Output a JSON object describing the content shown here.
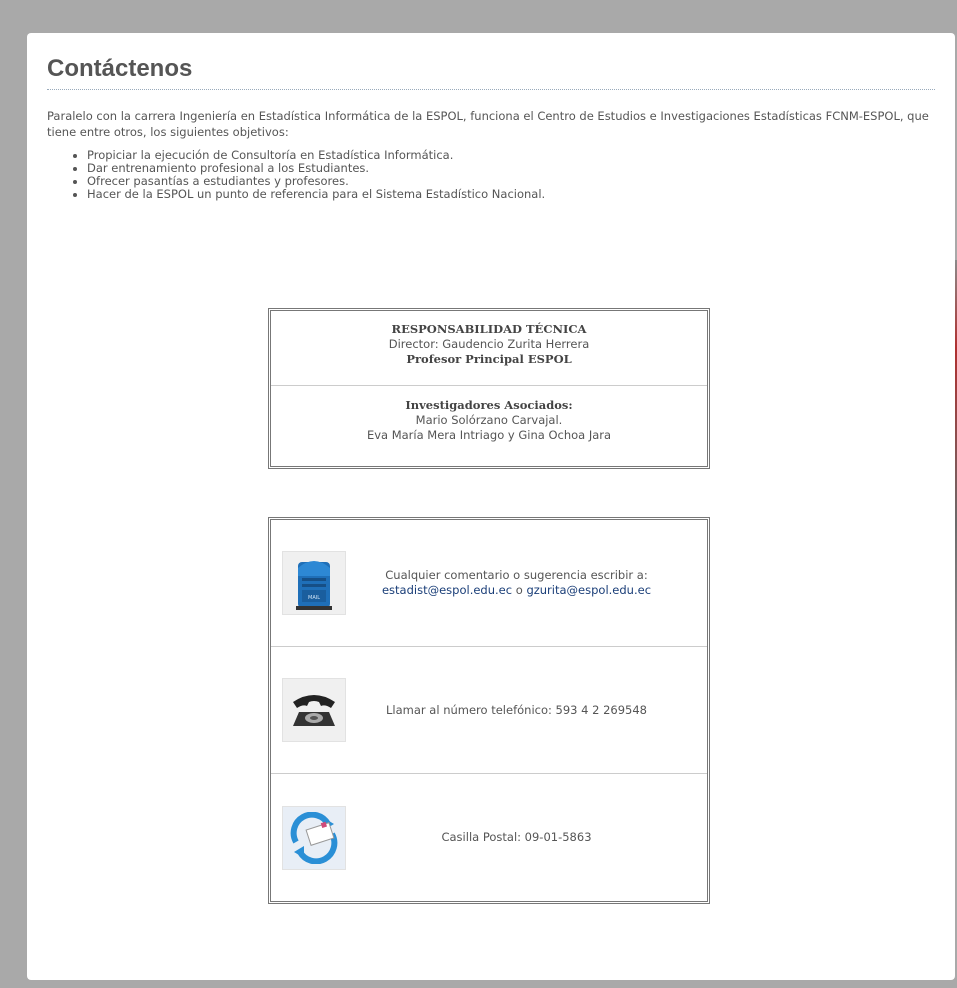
{
  "page": {
    "title": "Contáctenos",
    "intro": "Paralelo con la carrera Ingeniería en Estadística Informática de la ESPOL, funciona el Centro de Estudios e Investigaciones Estadísticas FCNM-ESPOL, que tiene entre otros, los siguientes objetivos:",
    "objectives": [
      "Propiciar la ejecución de Consultoría en Estadística Informática.",
      "Dar entrenamiento profesional a los Estudiantes.",
      "Ofrecer pasantías a estudiantes y profesores.",
      "Hacer de la ESPOL un punto de referencia para el Sistema Estadístico Nacional."
    ]
  },
  "responsabilidad": {
    "heading": "RESPONSABILIDAD TÉCNICA",
    "director": "Director: Gaudencio Zurita Herrera",
    "rank": "Profesor Principal ESPOL",
    "investigators_heading": "Investigadores Asociados:",
    "investigator_1": "Mario Solórzano Carvajal.",
    "investigator_2": "Eva María Mera Intriago y Gina Ochoa Jara"
  },
  "contact": {
    "mail_text": "Cualquier comentario o sugerencia escribir a:",
    "email_1": "estadist@espol.edu.ec",
    "email_sep": "o",
    "email_2": "gzurita@espol.edu.ec",
    "phone_text": "Llamar al número telefónico: 593 4 2 269548",
    "postal_text": "Casilla Postal: 09-01-5863",
    "mailbox_icon_label": "MAIL"
  },
  "icons": {
    "mailbox": "mailbox-icon",
    "phone": "telephone-icon",
    "postal": "envelope-sync-icon"
  },
  "colors": {
    "background": "#a9a9a9",
    "link": "#1a3e78",
    "text": "#555555"
  }
}
